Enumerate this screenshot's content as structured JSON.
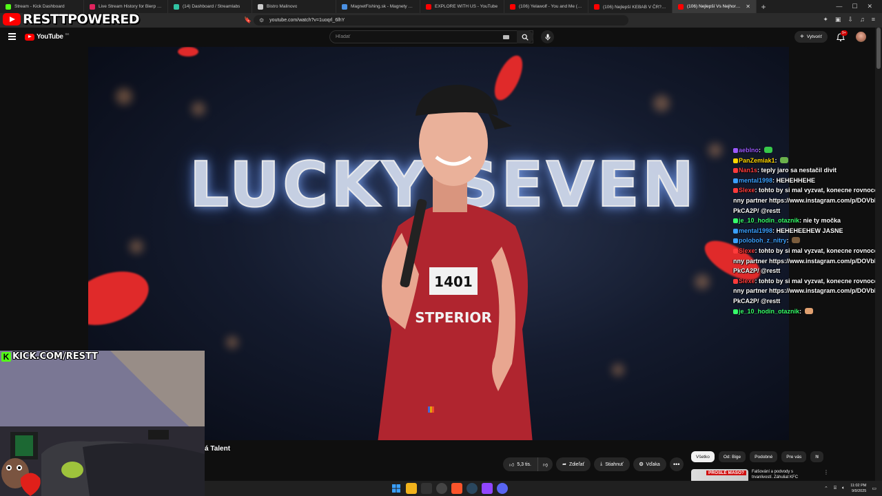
{
  "browser": {
    "tabs": [
      {
        "title": "Stream - Kick Dashboard",
        "color": "#53fc18"
      },
      {
        "title": "Live Stream History for Bierp Shares",
        "color": "#e0245e"
      },
      {
        "title": "(14) Dashboard / Streamlabs",
        "color": "#31c3a2"
      },
      {
        "title": "Bistro Malinovo",
        "color": "#cccccc"
      },
      {
        "title": "MagnetFishing.sk - Magnety a laná p",
        "color": "#4a90e2"
      },
      {
        "title": "EXPLORE WITH US - YouTube",
        "color": "#ff0000"
      },
      {
        "title": "(106) Yelawolf - You and Me (Officia",
        "color": "#ff0000"
      },
      {
        "title": "(106) Nejlepší KEBAB V ČR? 🥙 Prav",
        "color": "#ff0000"
      },
      {
        "title": "(106) Nejlepší Vs Nejhorší P...",
        "color": "#ff0000",
        "active": true
      }
    ],
    "url": "youtube.com/watch?v=1uoqrl_6lhY"
  },
  "overlay": {
    "brand": "RESTTPOWERED",
    "kick": "KICK.COM/RESTT"
  },
  "youtube": {
    "logo_text": "YouTube",
    "country": "SK",
    "search_placeholder": "Hľadať",
    "create_label": "Vytvoriť",
    "notif_count": "9+"
  },
  "video": {
    "overlay_text": "LUCKY SEVEN",
    "title_fragment": "á Talent"
  },
  "actions": {
    "likes": "5,3 tis.",
    "share": "Zdieľať",
    "download": "Stiahnuť",
    "thanks": "Vďaka"
  },
  "chips": [
    "Všetko",
    "Od: Bige",
    "Podobné",
    "Pre vás",
    "N"
  ],
  "recommendation": {
    "thumb_text": "PROSLÉ MASO?",
    "title": "Falšování a podvody s trvanlivostí. Záhuliat KFC"
  },
  "chat": [
    {
      "user": "aeblno",
      "color": "#9b59ff",
      "text": "",
      "emote": "#37c84a"
    },
    {
      "user": "PanZemiak1",
      "color": "#ffd700",
      "text": "",
      "emote": "#6ab04c"
    },
    {
      "user": "Nan1s",
      "color": "#ff3b3b",
      "text": "teply jaro sa nestačil divit"
    },
    {
      "user": "mental1998",
      "color": "#3aa0ff",
      "text": "HEHEHHEHE"
    },
    {
      "user": "Slexe",
      "color": "#ff3b3b",
      "text": "tohto by si mal vyzvat, konecne rovnocenny partner https://www.instagram.com/p/DOVbNPkCA2P/ @restt"
    },
    {
      "user": "je_10_hodin_otaznik",
      "color": "#36ff6a",
      "text": "nie ty močka"
    },
    {
      "user": "mental1998",
      "color": "#3aa0ff",
      "text": "HEHEHEEHEW JASNE"
    },
    {
      "user": "poloboh_z_nitry",
      "color": "#3aa0ff",
      "text": "",
      "emote": "#7a5c3c"
    },
    {
      "user": "Slexe",
      "color": "#ff3b3b",
      "text": "tohto by si mal vyzvat, konecne rovnocenny partner https://www.instagram.com/p/DOVbNPkCA2P/ @restt"
    },
    {
      "user": "Slexe",
      "color": "#ff3b3b",
      "text": "tohto by si mal vyzvat, konecne rovnocenny partner https://www.instagram.com/p/DOVbNPkCA2P/ @restt"
    },
    {
      "user": "je_10_hodin_otaznik",
      "color": "#36ff6a",
      "text": "",
      "emote": "#e0a070"
    }
  ],
  "taskbar": {
    "time": "11:02 PM",
    "date": "9/9/2025"
  }
}
